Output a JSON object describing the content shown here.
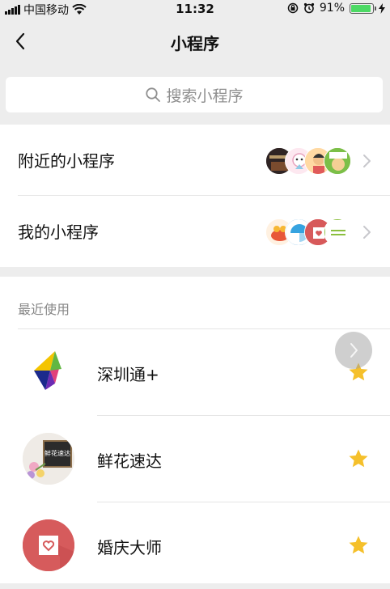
{
  "status_bar": {
    "carrier": "中国移动",
    "time": "11:32",
    "battery_percent": "91%",
    "battery_level": 0.91
  },
  "nav": {
    "title": "小程序",
    "back_icon": "chevron-left-icon"
  },
  "search": {
    "placeholder": "搜索小程序"
  },
  "menu": [
    {
      "label": "附近的小程序"
    },
    {
      "label": "我的小程序"
    }
  ],
  "recent": {
    "title": "最近使用",
    "apps": [
      {
        "name": "深圳通+",
        "icon": "shenzhentong-logo",
        "starred": true
      },
      {
        "name": "鲜花速达",
        "icon": "flower-shop-logo",
        "starred": true,
        "icon_text": "鲜花速达"
      },
      {
        "name": "婚庆大师",
        "icon": "heart-frame-logo",
        "starred": true
      }
    ]
  },
  "colors": {
    "background": "#ededed",
    "star": "#f5c02b",
    "battery": "#4cd964",
    "text_secondary": "#888888"
  }
}
